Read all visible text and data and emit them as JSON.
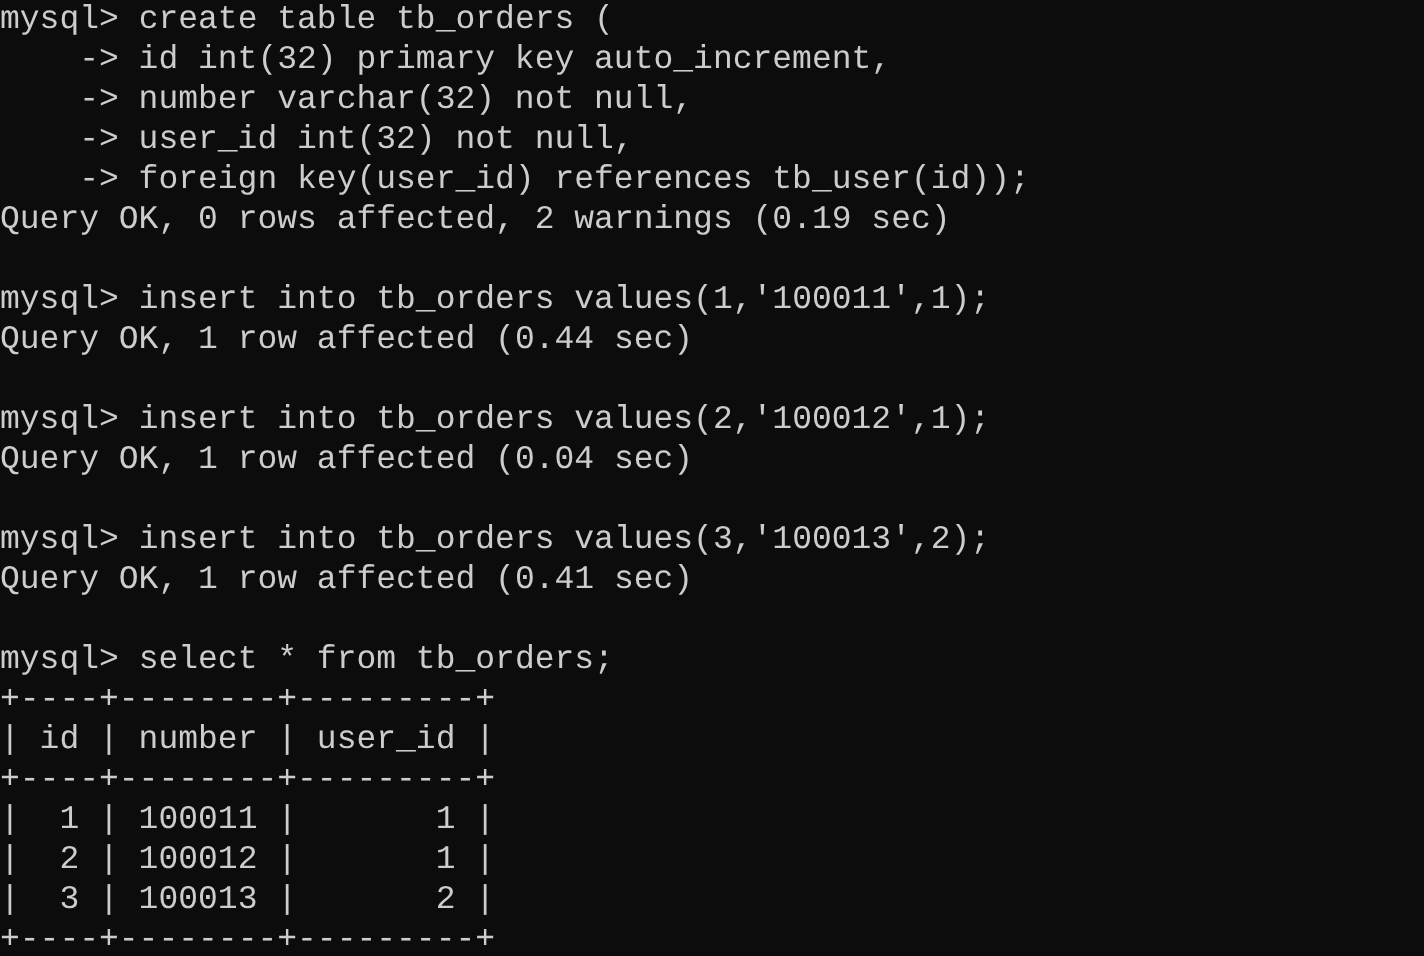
{
  "session": [
    {
      "prompt": "mysql>",
      "command": "create table tb_orders (",
      "continuations": [
        {
          "prompt": "->",
          "text": "id int(32) primary key auto_increment,"
        },
        {
          "prompt": "->",
          "text": "number varchar(32) not null,"
        },
        {
          "prompt": "->",
          "text": "user_id int(32) not null,"
        },
        {
          "prompt": "->",
          "text": "foreign key(user_id) references tb_user(id));"
        }
      ],
      "output": [
        "Query OK, 0 rows affected, 2 warnings (0.19 sec)"
      ]
    },
    {
      "prompt": "mysql>",
      "command": "insert into tb_orders values(1,'100011',1);",
      "output": [
        "Query OK, 1 row affected (0.44 sec)"
      ]
    },
    {
      "prompt": "mysql>",
      "command": "insert into tb_orders values(2,'100012',1);",
      "output": [
        "Query OK, 1 row affected (0.04 sec)"
      ]
    },
    {
      "prompt": "mysql>",
      "command": "insert into tb_orders values(3,'100013',2);",
      "output": [
        "Query OK, 1 row affected (0.41 sec)"
      ]
    },
    {
      "prompt": "mysql>",
      "command": "select * from tb_orders;",
      "output": [
        "+----+--------+---------+",
        "| id | number | user_id |",
        "+----+--------+---------+",
        "|  1 | 100011 |       1 |",
        "|  2 | 100012 |       1 |",
        "|  3 | 100013 |       2 |",
        "+----+--------+---------+"
      ]
    }
  ]
}
